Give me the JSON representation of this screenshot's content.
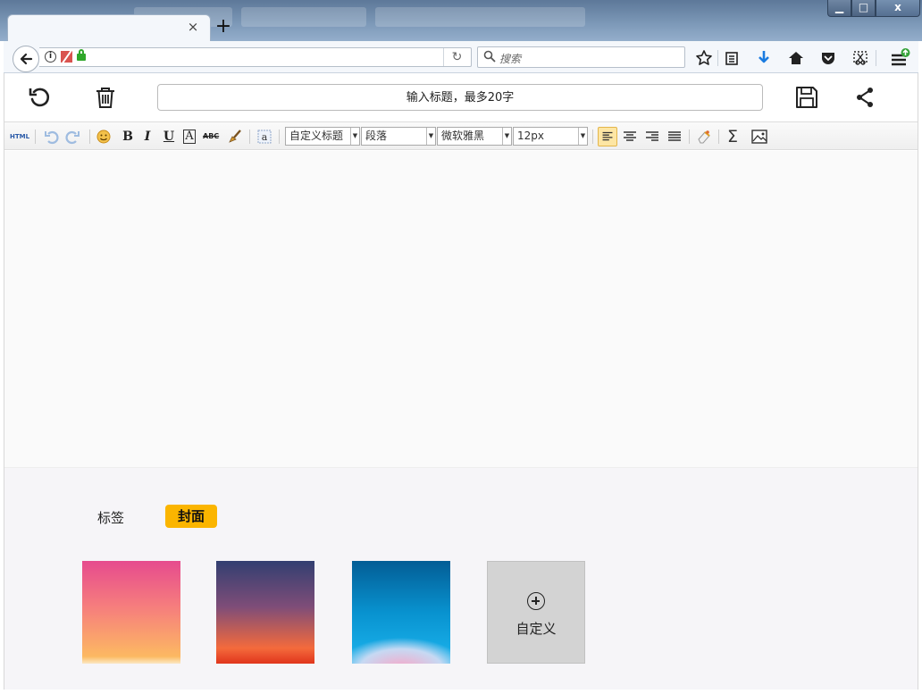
{
  "browser": {
    "tab_close": "×",
    "new_tab": "+",
    "window_buttons": {
      "minimize": "▁",
      "maximize": "□",
      "close": "x"
    },
    "search_placeholder": "搜索",
    "icons": [
      "back-arrow-icon",
      "info-icon",
      "blocked-content-icon",
      "lock-icon",
      "reload-icon",
      "search-icon",
      "star-icon",
      "reading-list-icon",
      "download-icon",
      "home-icon",
      "pocket-icon",
      "screenshot-icon",
      "menu-icon"
    ]
  },
  "editor": {
    "title_placeholder": "输入标题，最多20字",
    "toolbar": {
      "html_label": "HTML",
      "bold": "B",
      "italic": "I",
      "underline": "U",
      "font_color": "A",
      "strike": "ABC",
      "custom_heading": "自定义标题",
      "paragraph": "段落",
      "font_family": "微软雅黑",
      "font_size": "12px",
      "formula": "Σ",
      "active_align": "left"
    }
  },
  "panel": {
    "tabs": [
      {
        "label": "标签",
        "active": false
      },
      {
        "label": "封面",
        "active": true
      }
    ],
    "custom_label": "自定义",
    "accent_color": "#fbb500"
  }
}
